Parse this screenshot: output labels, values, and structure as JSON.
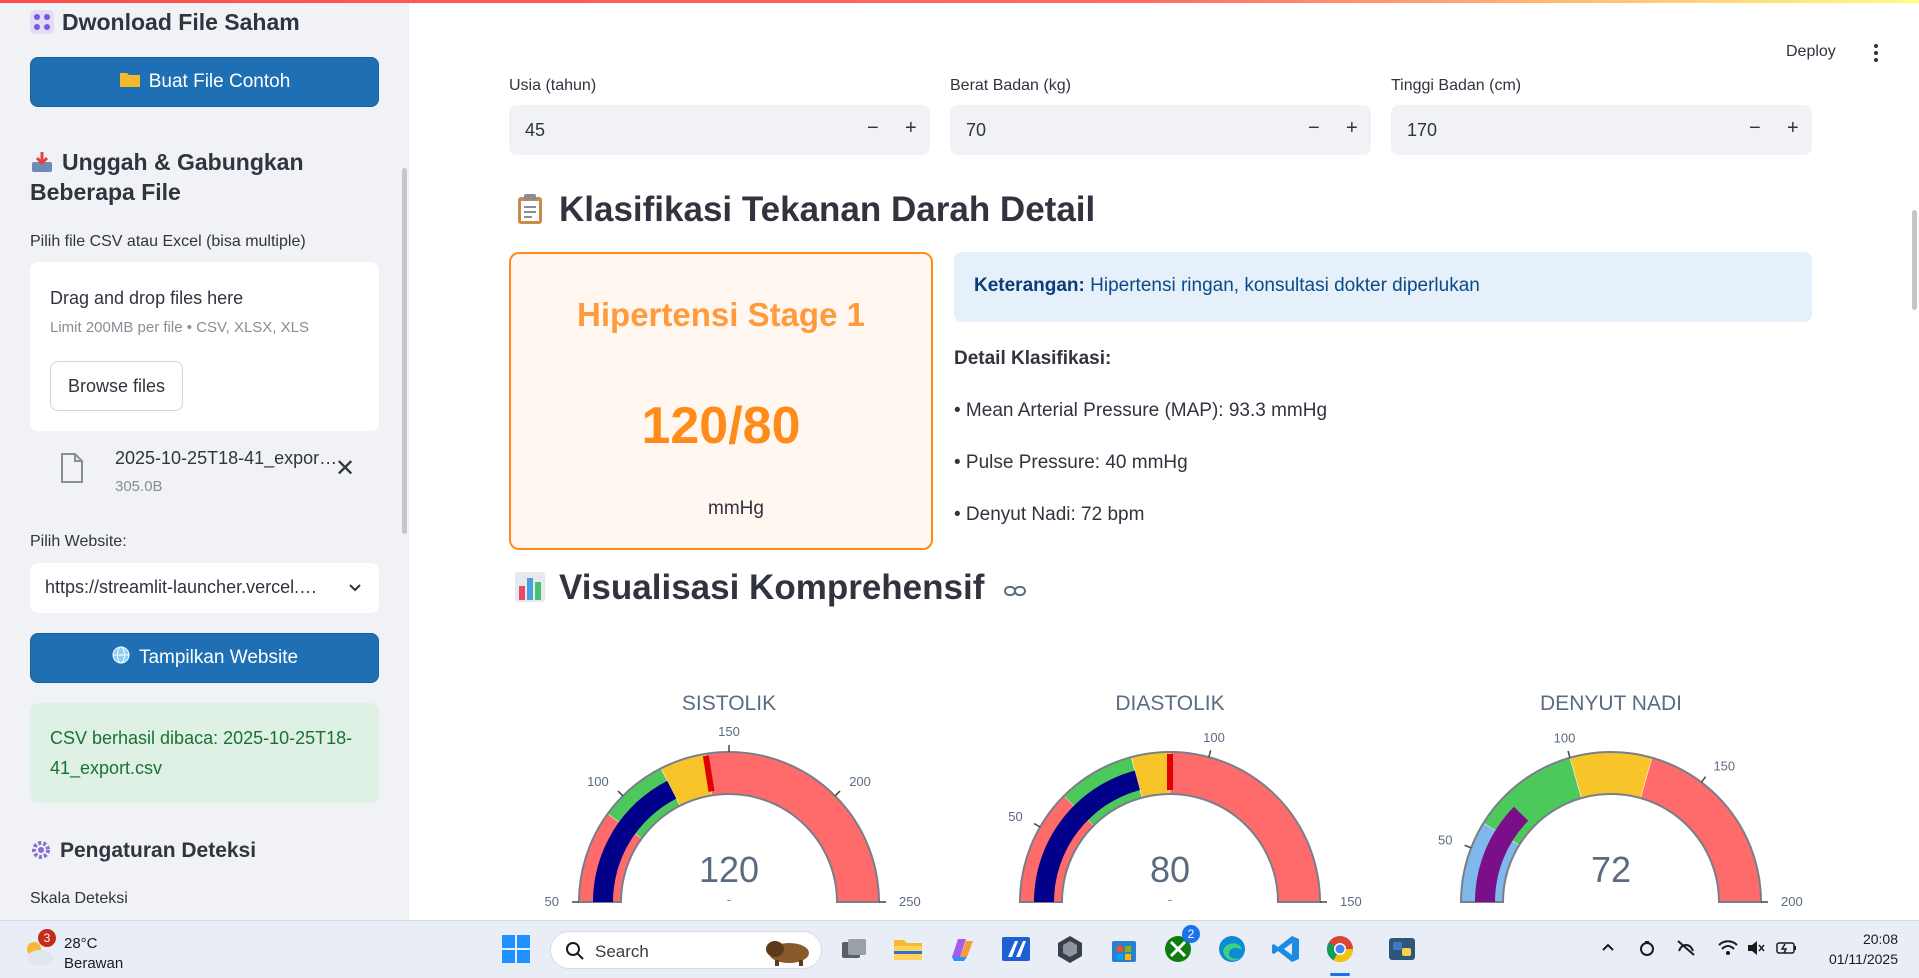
{
  "sidebar": {
    "download_title": "Dwonload File Saham",
    "sample_button": "Buat File Contoh",
    "upload_title_line1": "Unggah & Gabungkan",
    "upload_title_line2": "Beberapa File",
    "file_picker_label": "Pilih file CSV atau Excel (bisa multiple)",
    "uploader": {
      "drag_text": "Drag and drop files here",
      "limit_text": "Limit 200MB per file • CSV, XLSX, XLS",
      "browse_button": "Browse files"
    },
    "uploaded_file": {
      "name": "2025-10-25T18-41_export.csv",
      "size": "305.0B"
    },
    "website_label": "Pilih Website:",
    "website_selected": "https://streamlit-launcher.vercel.app",
    "show_website_button": "Tampilkan Website",
    "success_message": "CSV berhasil dibaca: 2025-10-25T18-41_export.csv",
    "detection_title": "Pengaturan Deteksi",
    "scale_label": "Skala Deteksi"
  },
  "header": {
    "deploy": "Deploy"
  },
  "inputs": [
    {
      "label": "Usia (tahun)",
      "value": "45"
    },
    {
      "label": "Berat Badan (kg)",
      "value": "70"
    },
    {
      "label": "Tinggi Badan (cm)",
      "value": "170"
    }
  ],
  "classification": {
    "heading": "Klasifikasi Tekanan Darah Detail",
    "category": "Hipertensi Stage 1",
    "reading": "120/80",
    "unit": "mmHg",
    "note_label": "Keterangan:",
    "note_text": "Hipertensi ringan, konsultasi dokter diperlukan",
    "detail_title": "Detail Klasifikasi:",
    "details": [
      "• Mean Arterial Pressure (MAP): 93.3 mmHg",
      "• Pulse Pressure: 40 mmHg",
      "• Denyut Nadi: 72 bpm"
    ]
  },
  "visualization": {
    "heading": "Visualisasi Komprehensif"
  },
  "gauges": [
    {
      "title": "SISTOLIK",
      "value": 120,
      "min": 50,
      "max": 250,
      "ticks": [
        50,
        100,
        150,
        200,
        250
      ],
      "bands": [
        [
          50,
          90,
          "#ff6b6b"
        ],
        [
          90,
          120,
          "#4cc95a"
        ],
        [
          120,
          140,
          "#f7c52a"
        ],
        [
          140,
          250,
          "#ff6b6b"
        ]
      ],
      "threshold": 140,
      "bar_color": "#00008b",
      "delta": "-"
    },
    {
      "title": "DIASTOLIK",
      "value": 80,
      "min": 30,
      "max": 150,
      "ticks": [
        50,
        100,
        150
      ],
      "bands": [
        [
          30,
          60,
          "#ff6b6b"
        ],
        [
          60,
          80,
          "#4cc95a"
        ],
        [
          80,
          90,
          "#f7c52a"
        ],
        [
          90,
          150,
          "#ff6b6b"
        ]
      ],
      "threshold": 90,
      "bar_color": "#00008b",
      "delta": "-"
    },
    {
      "title": "DENYUT NADI",
      "value": 72,
      "min": 30,
      "max": 200,
      "ticks": [
        50,
        100,
        150,
        200
      ],
      "bands": [
        [
          30,
          60,
          "#7fb8ea"
        ],
        [
          60,
          100,
          "#4cc95a"
        ],
        [
          100,
          130,
          "#f7c52a"
        ],
        [
          130,
          200,
          "#ff6b6b"
        ]
      ],
      "threshold": null,
      "bar_color": "#7b0f8a",
      "delta": ""
    }
  ],
  "colors": {
    "primary_button": "#1f6fb5",
    "warning": "#ff8c1a",
    "success_bg": "#dff1e4",
    "info_bg": "#e6f0fb"
  },
  "taskbar": {
    "weather_temp": "28°C",
    "weather_cond": "Berawan",
    "weather_badge": "3",
    "search_placeholder": "Search",
    "xbox_badge": "2",
    "time": "20:08",
    "date": "01/11/2025"
  }
}
